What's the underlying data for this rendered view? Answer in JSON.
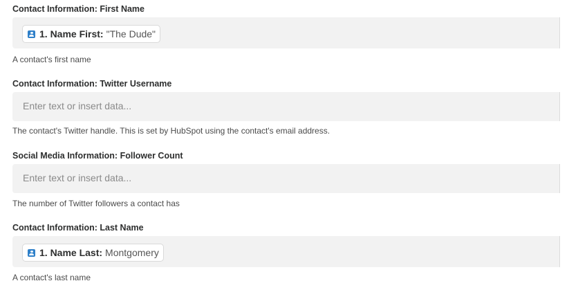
{
  "fields": [
    {
      "label": "Contact Information: First Name",
      "pill_key": "1. Name First:",
      "pill_value": "\"The Dude\"",
      "help": "A contact's first name",
      "pill_icon": "contact-card-icon",
      "pill_icon_color": "#2f80c9"
    },
    {
      "label": "Contact Information: Twitter Username",
      "placeholder": "Enter text or insert data...",
      "help": "The contact's Twitter handle. This is set by HubSpot using the contact's email address."
    },
    {
      "label": "Social Media Information: Follower Count",
      "placeholder": "Enter text or insert data...",
      "help": "The number of Twitter followers a contact has"
    },
    {
      "label": "Contact Information: Last Name",
      "pill_key": "1. Name Last:",
      "pill_value": "Montgomery",
      "help": "A contact's last name",
      "pill_icon": "contact-card-icon",
      "pill_icon_color": "#2f80c9"
    }
  ]
}
